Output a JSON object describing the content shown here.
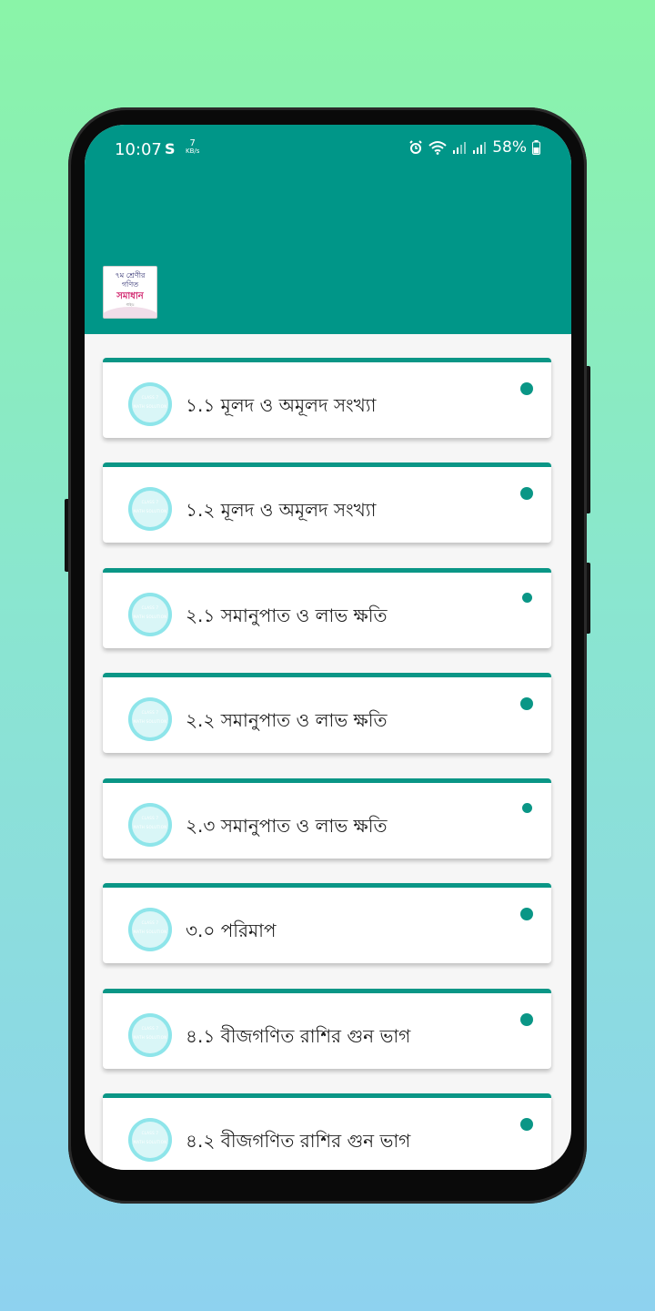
{
  "status_bar": {
    "time": "10:07",
    "net_speed_value": "7",
    "net_speed_unit": "KB/s",
    "battery": "58%"
  },
  "logo": {
    "line1": "৭ম শ্রেণীর",
    "line2": "গণিত",
    "line3": "সমাধান",
    "line4": "গাইড"
  },
  "colors": {
    "primary": "#009688",
    "card_accent": "#0a9686",
    "badge_ring": "#8ee5ea"
  },
  "chapters": [
    {
      "label": "১.১ মূলদ ও অমূলদ সংখ্যা",
      "badge_line1": "CLASS 7",
      "badge_line2": "MATH SOLUTION"
    },
    {
      "label": "১.২ মূলদ ও অমূলদ সংখ্যা",
      "badge_line1": "CLASS 7",
      "badge_line2": "MATH SOLUTION"
    },
    {
      "label": "২.১ সমানুপাত ও লাভ ক্ষতি",
      "badge_line1": "CLASS 7",
      "badge_line2": "MATH SOLUTION"
    },
    {
      "label": "২.২ সমানুপাত ও লাভ ক্ষতি",
      "badge_line1": "CLASS 7",
      "badge_line2": "MATH SOLUTION"
    },
    {
      "label": "২.৩ সমানুপাত ও লাভ ক্ষতি",
      "badge_line1": "CLASS 7",
      "badge_line2": "MATH SOLUTION"
    },
    {
      "label": "৩.০ পরিমাপ",
      "badge_line1": "CLASS 7",
      "badge_line2": "MATH SOLUTION"
    },
    {
      "label": "৪.১ বীজগণিত রাশির গুন ভাগ",
      "badge_line1": "CLASS 7",
      "badge_line2": "MATH SOLUTION"
    },
    {
      "label": "৪.২ বীজগণিত রাশির গুন ভাগ",
      "badge_line1": "CLASS 7",
      "badge_line2": "MATH SOLUTION"
    }
  ]
}
